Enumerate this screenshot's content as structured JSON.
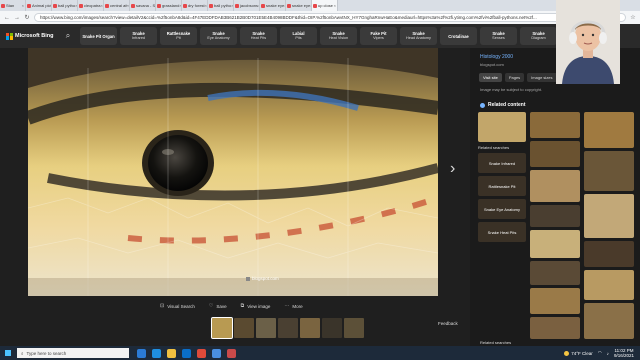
{
  "browser": {
    "tabs": [
      {
        "label": "Stan"
      },
      {
        "label": "Animal pictu"
      },
      {
        "label": "ball pytho"
      },
      {
        "label": "cleopatra"
      },
      {
        "label": "central afr"
      },
      {
        "label": "savana - S"
      },
      {
        "label": "grassland"
      },
      {
        "label": "dry forest"
      },
      {
        "label": "ball pytho"
      },
      {
        "label": "jacobsons"
      },
      {
        "label": "snake eye"
      },
      {
        "label": "snake eye"
      },
      {
        "label": "up close"
      }
    ],
    "url": "https://www.bing.com/images/search?view=detailV2&ccid=%2f5onbA8d&id=4F47EDDFDAB3B621B2B0D701E5E4B4098BDDF&thid=OIP.%2f5onbAwvtNX_HY7GnghaRnwHaEo&mediaurl=https%3a%2f%2fi.ytimg.com%2fvi%2fball-pythons.net%2f..."
  },
  "bing": {
    "logo_text": "Microsoft Bing",
    "related_chips": [
      {
        "title": "Snake Pit Organ",
        "sub": ""
      },
      {
        "title": "Snake",
        "sub": "Infrared"
      },
      {
        "title": "Rattlesnake",
        "sub": "Pit"
      },
      {
        "title": "Snake",
        "sub": "Eye Anatomy"
      },
      {
        "title": "Snake",
        "sub": "Heat Pits"
      },
      {
        "title": "Labial",
        "sub": "Pits"
      },
      {
        "title": "Snake",
        "sub": "Heat Vision"
      },
      {
        "title": "Fake Pit",
        "sub": "Vipers"
      },
      {
        "title": "Snake",
        "sub": "Head Anatomy"
      },
      {
        "title": "Crotalinae",
        "sub": ""
      },
      {
        "title": "Snake",
        "sub": "Senses"
      },
      {
        "title": "Snake",
        "sub": "Diagram"
      }
    ]
  },
  "viewer": {
    "image_credit": "blogspot.com",
    "actions": [
      {
        "label": "Visual Search",
        "icon": "visual-search-icon"
      },
      {
        "label": "Save",
        "icon": "save-icon"
      },
      {
        "label": "View image",
        "icon": "view-image-icon"
      },
      {
        "label": "More",
        "icon": "more-icon"
      }
    ],
    "feedback": "Feedback"
  },
  "panel": {
    "title": "Histology 2000",
    "site": "blogspot.com",
    "buttons": [
      "Visit site",
      "Pages",
      "Image sizes"
    ],
    "copyright": "Image may be subject to copyright.",
    "related_content": "Related content",
    "related_searches_title": "Related searches",
    "related_searches": [
      "Snake Infrared",
      "Rattlesnake Pit",
      "Snake Eye Anatomy",
      "Snake Heat Pits"
    ],
    "related_searches_more": "Related searches"
  },
  "taskbar": {
    "search_placeholder": "Type here to search",
    "weather": "74°F Clear",
    "time": "11:02 PM",
    "date": "9/16/2021"
  },
  "colors": {
    "accent": "#76b4ff",
    "bing_bar": "#2a2a2a",
    "background": "#1b1b1b"
  }
}
